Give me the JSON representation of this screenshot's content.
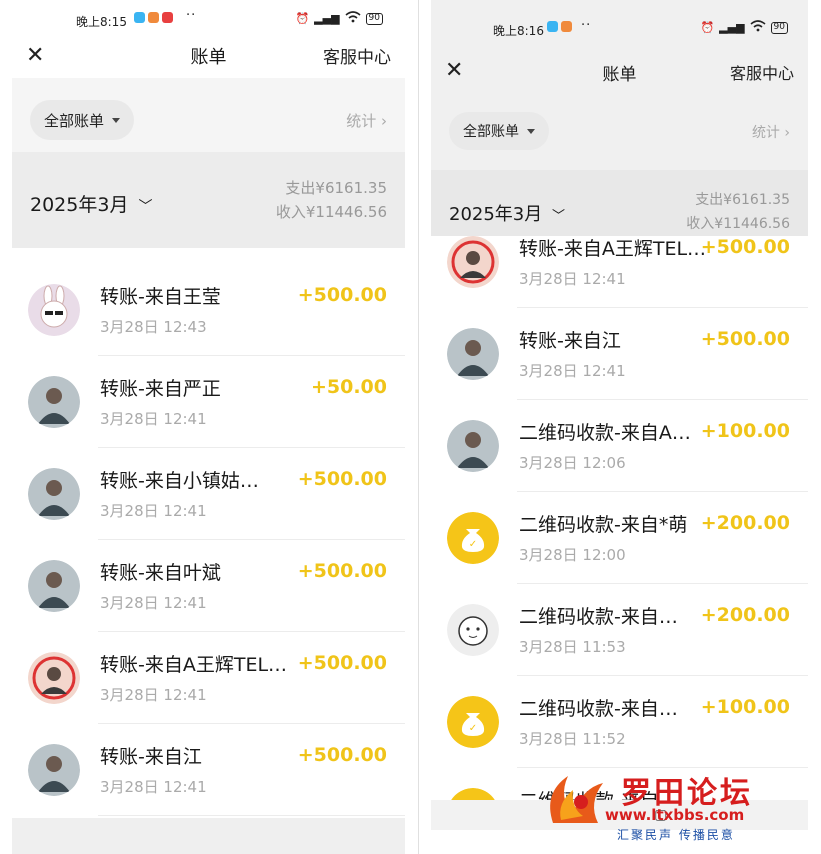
{
  "colors": {
    "amount": "#f0c419",
    "filter_bg": "#f5f5f5",
    "month_bg": "#ececec",
    "watermark_red": "#d61e1e",
    "watermark_blue": "#1c4fa5"
  },
  "left": {
    "status": {
      "time": "晚上8:15",
      "battery": "90",
      "dots": "··"
    },
    "topbar": {
      "close_icon": "close-icon",
      "title": "账单",
      "service": "客服中心"
    },
    "filter": {
      "label": "全部账单",
      "stats": "统计 ›"
    },
    "month": {
      "label": "2025年3月",
      "expense": "支出¥6161.35",
      "income": "收入¥11446.56"
    },
    "rows": [
      {
        "title": "转账-来自王莹",
        "time": "3月28日 12:43",
        "amount": "+500.00",
        "avatar": "rabbit-avatar"
      },
      {
        "title": "转账-来自严正",
        "time": "3月28日 12:41",
        "amount": "+50.00",
        "avatar": "person-avatar"
      },
      {
        "title": "转账-来自小镇姑…",
        "time": "3月28日 12:41",
        "amount": "+500.00",
        "avatar": "person-avatar"
      },
      {
        "title": "转账-来自叶斌",
        "time": "3月28日 12:41",
        "amount": "+500.00",
        "avatar": "person-avatar"
      },
      {
        "title": "转账-来自A王辉TEL…",
        "time": "3月28日 12:41",
        "amount": "+500.00",
        "avatar": "framed-avatar"
      },
      {
        "title": "转账-来自江",
        "time": "3月28日 12:41",
        "amount": "+500.00",
        "avatar": "person-avatar"
      }
    ]
  },
  "right": {
    "status": {
      "time": "晚上8:16",
      "battery": "90",
      "dots": "··"
    },
    "topbar": {
      "close_icon": "close-icon",
      "title": "账单",
      "service": "客服中心"
    },
    "filter": {
      "label": "全部账单",
      "stats": "统计 ›"
    },
    "month": {
      "label": "2025年3月",
      "expense": "支出¥6161.35",
      "income": "收入¥11446.56"
    },
    "rows": [
      {
        "title": "转账-来自A王辉TEL…",
        "time": "3月28日 12:41",
        "amount": "+500.00",
        "avatar": "framed-avatar"
      },
      {
        "title": "转账-来自江",
        "time": "3月28日 12:41",
        "amount": "+500.00",
        "avatar": "person-avatar"
      },
      {
        "title": "二维码收款-来自A…",
        "time": "3月28日 12:06",
        "amount": "+100.00",
        "avatar": "person-avatar"
      },
      {
        "title": "二维码收款-来自*萌",
        "time": "3月28日 12:00",
        "amount": "+200.00",
        "avatar": "money-bag-icon"
      },
      {
        "title": "二维码收款-来自…",
        "time": "3月28日 11:53",
        "amount": "+200.00",
        "avatar": "cartoon-avatar"
      },
      {
        "title": "二维码收款-来自…",
        "time": "3月28日 11:52",
        "amount": "+100.00",
        "avatar": "money-bag-icon"
      },
      {
        "title": "二维码收款-来自",
        "time": "",
        "amount": "",
        "avatar": "money-bag-icon"
      }
    ],
    "navbar": {
      "menu": "☰",
      "home": "▢"
    }
  },
  "watermark": {
    "title": "罗田论坛",
    "url": "www.ltxbbs.com",
    "slogan": "汇聚民声 传播民意"
  }
}
